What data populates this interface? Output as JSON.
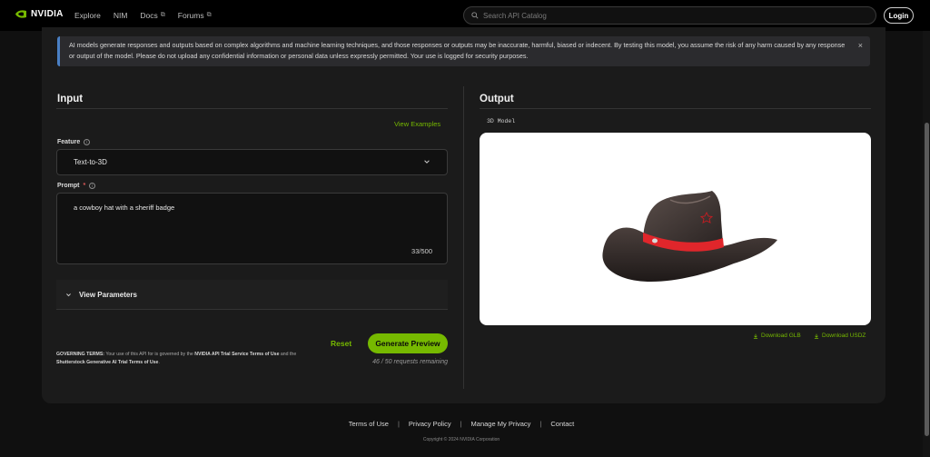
{
  "nav": {
    "brand": "NVIDIA",
    "links": [
      {
        "label": "Explore"
      },
      {
        "label": "NIM"
      },
      {
        "label": "Docs",
        "external": true
      },
      {
        "label": "Forums",
        "external": true
      }
    ],
    "search_placeholder": "Search API Catalog",
    "login_label": "Login"
  },
  "banner": {
    "text": "AI models generate responses and outputs based on complex algorithms and machine learning techniques, and those responses or outputs may be inaccurate, harmful, biased or indecent. By testing this model, you assume the risk of any harm caused by any response or output of the model. Please do not upload any confidential information or personal data unless expressly permitted. Your use is logged for security purposes.",
    "close": "×"
  },
  "input": {
    "title": "Input",
    "view_examples": "View Examples",
    "feature_label": "Feature",
    "feature_value": "Text-to-3D",
    "prompt_label": "Prompt",
    "prompt_required": "*",
    "prompt_value": "a cowboy hat with a sheriff badge",
    "prompt_count": "33/500",
    "params_label": "View Parameters",
    "terms_prefix": "GOVERNING TERMS:",
    "terms_mid": " Your use of this API for is governed by the ",
    "terms_link1": "NVIDIA API Trial Service Terms of Use",
    "terms_and": " and the ",
    "terms_link2": "Shutterstock Generative AI Trial Terms of Use",
    "terms_end": ".",
    "reset_label": "Reset",
    "generate_label": "Generate Preview",
    "remaining": "46 / 50 requests remaining"
  },
  "output": {
    "title": "Output",
    "model_label": "3D Model",
    "download_glb": "Download GLB",
    "download_usdz": "Download USDZ"
  },
  "footer": {
    "links": [
      "Terms of Use",
      "Privacy Policy",
      "Manage My Privacy",
      "Contact"
    ],
    "separator": "|",
    "copyright": "Copyright © 2024 NVIDIA Corporation"
  },
  "colors": {
    "accent": "#76b900",
    "banner_border": "#4a7fc4",
    "hat_band": "#e0262b"
  }
}
